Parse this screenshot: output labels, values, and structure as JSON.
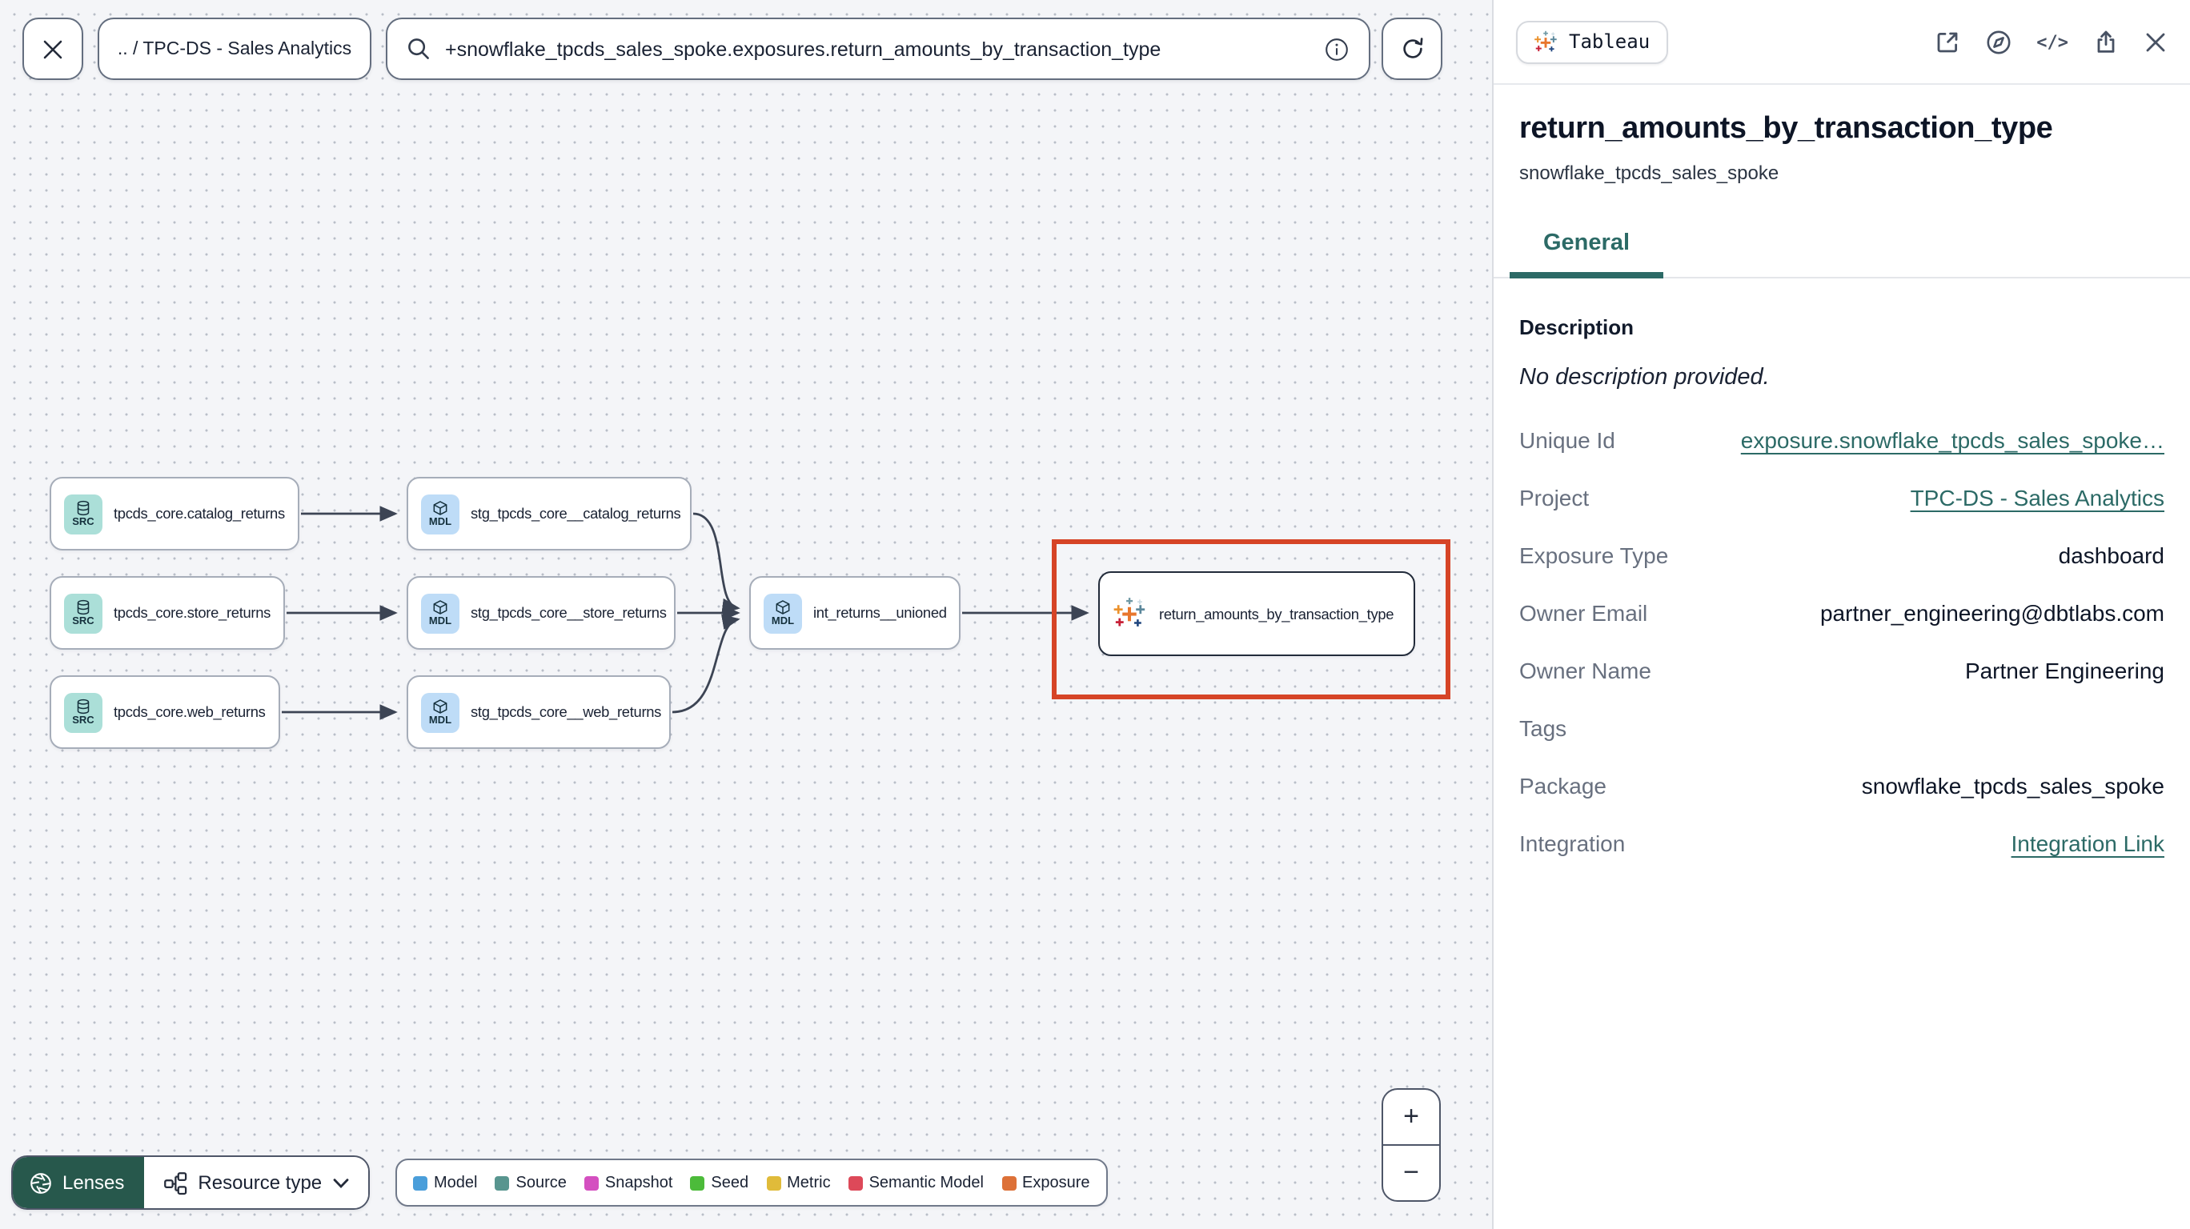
{
  "colors": {
    "accent_teal": "#2c6a66",
    "highlight_red": "#d64426",
    "lenses_bg": "#27584c"
  },
  "topbar": {
    "breadcrumb": ".. / TPC-DS - Sales Analytics",
    "search_value": "+snowflake_tpcds_sales_spoke.exposures.return_amounts_by_transaction_type"
  },
  "graph": {
    "nodes": [
      {
        "badge": "SRC",
        "label": "tpcds_core.catalog_returns"
      },
      {
        "badge": "SRC",
        "label": "tpcds_core.store_returns"
      },
      {
        "badge": "SRC",
        "label": "tpcds_core.web_returns"
      },
      {
        "badge": "MDL",
        "label": "stg_tpcds_core__catalog_returns"
      },
      {
        "badge": "MDL",
        "label": "stg_tpcds_core__store_returns"
      },
      {
        "badge": "MDL",
        "label": "stg_tpcds_core__web_returns"
      },
      {
        "badge": "MDL",
        "label": "int_returns__unioned"
      },
      {
        "badge": "tableau",
        "label": "return_amounts_by_transaction_type"
      }
    ]
  },
  "toolbar": {
    "lenses": "Lenses",
    "resource_type": "Resource type",
    "zoom_in": "+",
    "zoom_out": "−"
  },
  "legend": {
    "items": [
      {
        "label": "Model",
        "color": "#4a9eda"
      },
      {
        "label": "Source",
        "color": "#58958f"
      },
      {
        "label": "Snapshot",
        "color": "#d44fc0"
      },
      {
        "label": "Seed",
        "color": "#4cbb3a"
      },
      {
        "label": "Metric",
        "color": "#e0bb3a"
      },
      {
        "label": "Semantic Model",
        "color": "#dd4959"
      },
      {
        "label": "Exposure",
        "color": "#dd7138"
      }
    ]
  },
  "panel": {
    "badge": "Tableau",
    "title": "return_amounts_by_transaction_type",
    "subtitle": "snowflake_tpcds_sales_spoke",
    "tab": "General",
    "description_header": "Description",
    "description_empty": "No description provided.",
    "rows": [
      {
        "label": "Unique Id",
        "value": "exposure.snowflake_tpcds_sales_spoke…",
        "link": true
      },
      {
        "label": "Project",
        "value": "TPC-DS - Sales Analytics",
        "link": true
      },
      {
        "label": "Exposure Type",
        "value": "dashboard",
        "link": false
      },
      {
        "label": "Owner Email",
        "value": "partner_engineering@dbtlabs.com",
        "link": false
      },
      {
        "label": "Owner Name",
        "value": "Partner Engineering",
        "link": false
      },
      {
        "label": "Tags",
        "value": "",
        "link": false
      },
      {
        "label": "Package",
        "value": "snowflake_tpcds_sales_spoke",
        "link": false
      },
      {
        "label": "Integration",
        "value": "Integration Link",
        "link": true
      }
    ]
  }
}
